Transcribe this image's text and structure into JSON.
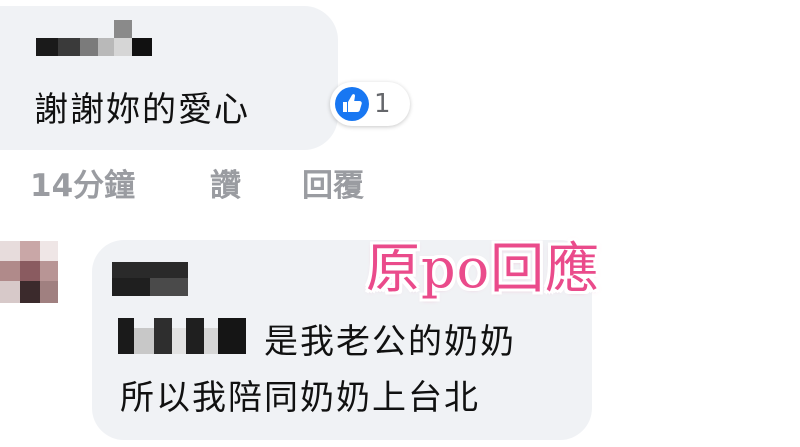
{
  "comment1": {
    "author_name": "",
    "text": "謝謝妳的愛心",
    "reaction": {
      "icon": "thumbs-up-icon",
      "count": "1",
      "color": "#1877f2"
    }
  },
  "actions": {
    "time": "14分鐘",
    "like": "讚",
    "reply": "回覆"
  },
  "comment2": {
    "author_name": "",
    "line1": "是我老公的奶奶",
    "line2": "所以我陪同奶奶上台北"
  },
  "annotation": {
    "text": "原po回應",
    "color": "#ea4b8b"
  },
  "colors": {
    "bubble": "#f0f2f5",
    "meta_text": "#9a9ca1",
    "body_text": "#111111"
  }
}
